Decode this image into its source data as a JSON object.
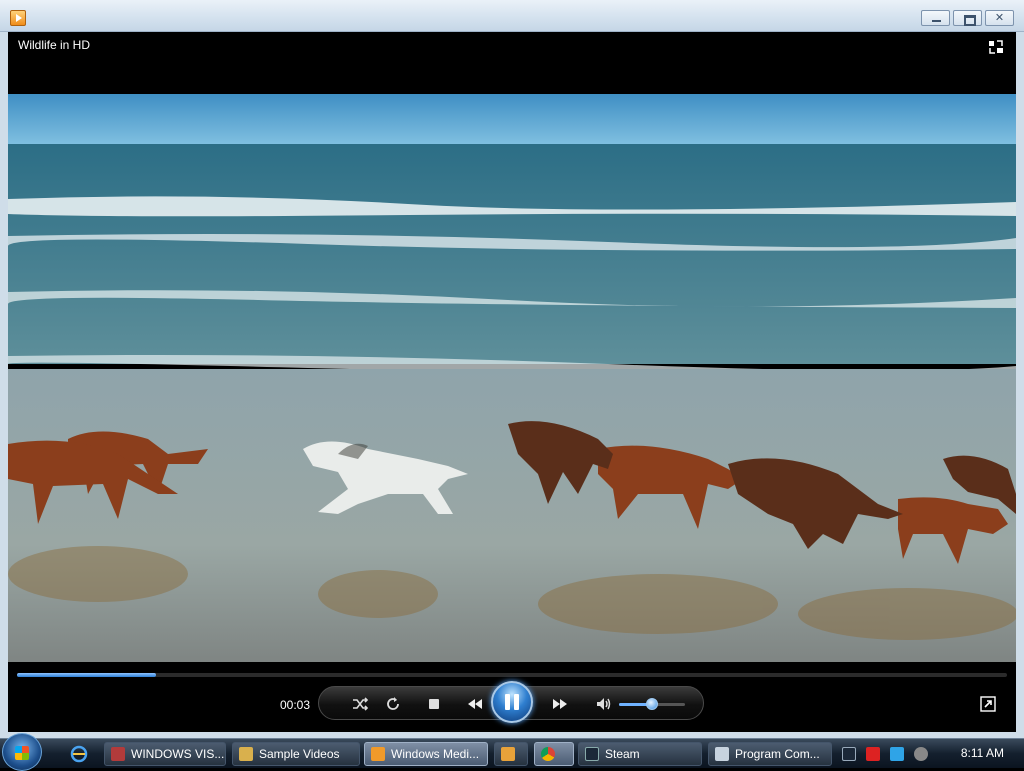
{
  "window": {
    "app_icon": "windows-media-player-icon",
    "buttons": {
      "minimize": "minimize-icon",
      "maximize": "maximize-icon",
      "close_label": "✕"
    }
  },
  "player": {
    "media_title": "Wildlife in HD",
    "switch_to_library_icon": "switch-to-library-icon",
    "time_elapsed": "00:03",
    "seek_progress_fraction": 0.14,
    "volume_fraction": 0.5,
    "controls": {
      "shuffle_icon": "shuffle-icon",
      "repeat_icon": "repeat-icon",
      "stop_icon": "stop-icon",
      "previous_icon": "previous-icon",
      "pause_icon": "pause-icon",
      "next_icon": "next-icon",
      "mute_icon": "speaker-icon",
      "fullscreen_icon": "fullscreen-icon"
    },
    "accent_color": "#2d7fd6"
  },
  "taskbar": {
    "start_icon": "start-orb-icon",
    "quick_launch": [
      "internet-explorer-icon"
    ],
    "tasks": [
      {
        "label": "WINDOWS VIS...",
        "icon": "app-icon",
        "active": false
      },
      {
        "label": "Sample Videos",
        "icon": "folder-icon",
        "active": false
      },
      {
        "label": "Windows Medi...",
        "icon": "windows-media-player-icon",
        "active": true
      },
      {
        "label": "",
        "icon": "paint-icon",
        "active": false
      },
      {
        "label": "",
        "icon": "chrome-icon",
        "active": false
      },
      {
        "label": "Steam",
        "icon": "steam-icon",
        "active": false
      },
      {
        "label": "Program Com...",
        "icon": "program-icon",
        "active": false
      }
    ],
    "tray_icons": [
      "steam-tray-icon",
      "flag-tray-icon",
      "network-tray-icon",
      "volume-tray-icon"
    ],
    "clock": "8:11 AM"
  }
}
